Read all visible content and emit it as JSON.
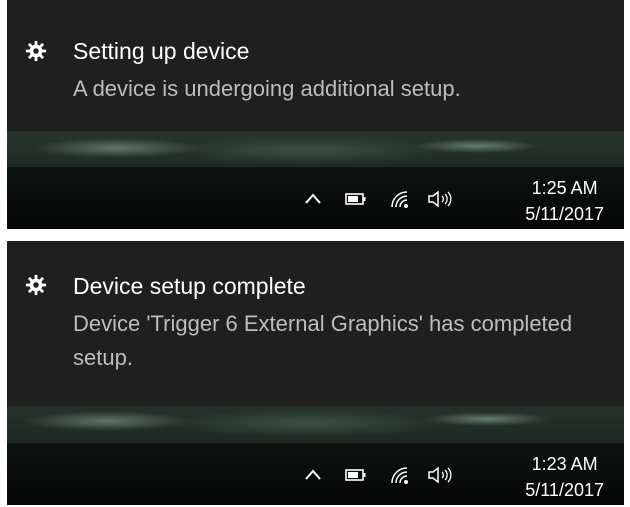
{
  "notifications": [
    {
      "title": "Setting up device",
      "body": "A device is undergoing additional setup.",
      "time": "1:25 AM",
      "date": "5/11/2017",
      "icon": "gear-icon"
    },
    {
      "title": "Device setup complete",
      "body": "Device 'Trigger 6 External Graphics' has completed setup.",
      "time": "1:23 AM",
      "date": "5/11/2017",
      "icon": "gear-icon"
    }
  ],
  "tray_icons": [
    "chevron-up-icon",
    "battery-icon",
    "wifi-icon",
    "volume-icon"
  ],
  "colors": {
    "toast_background": "#1f1f1f",
    "title_text": "#ffffff",
    "body_text": "#bdbdbd",
    "taskbar": "#0a0d0b"
  }
}
